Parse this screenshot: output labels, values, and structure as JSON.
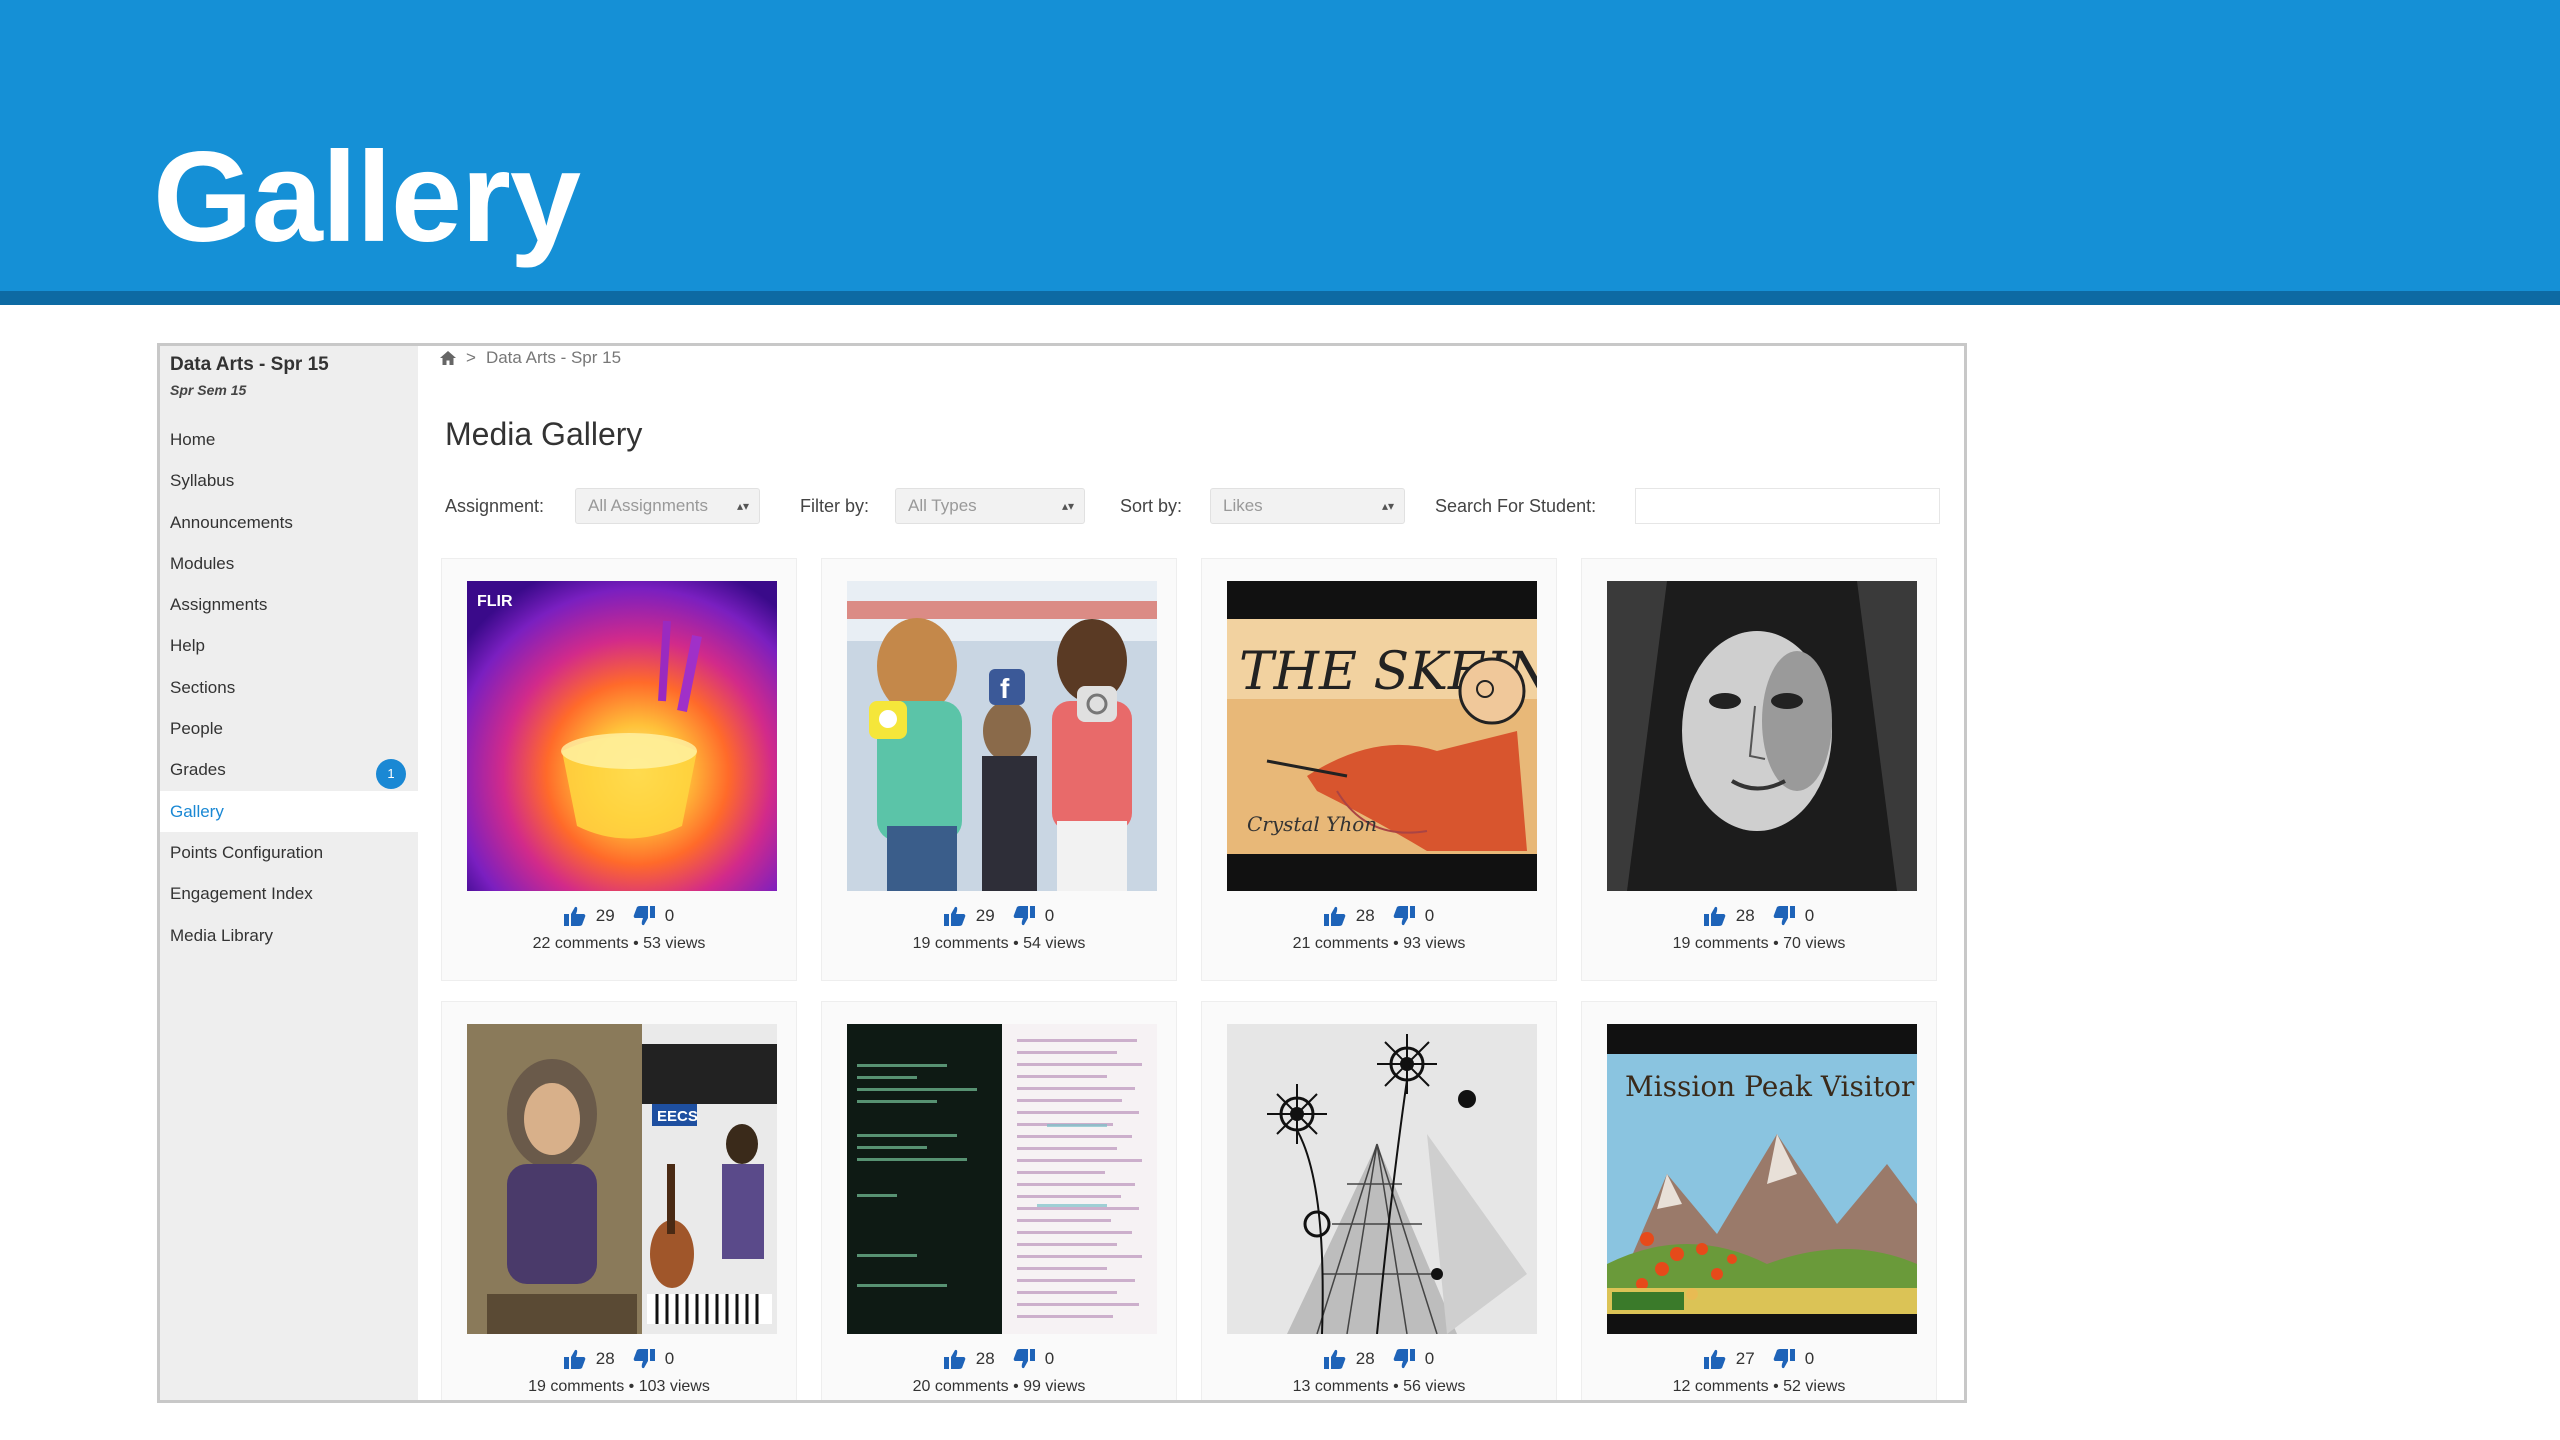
{
  "slide": {
    "title": "Gallery"
  },
  "sidebar": {
    "course_title": "Data Arts - Spr 15",
    "course_subtitle": "Spr Sem 15",
    "items": [
      {
        "label": "Home"
      },
      {
        "label": "Syllabus"
      },
      {
        "label": "Announcements"
      },
      {
        "label": "Modules"
      },
      {
        "label": "Assignments"
      },
      {
        "label": "Help"
      },
      {
        "label": "Sections"
      },
      {
        "label": "People"
      },
      {
        "label": "Grades",
        "badge": "1"
      },
      {
        "label": "Gallery",
        "active": true
      },
      {
        "label": "Points Configuration"
      },
      {
        "label": "Engagement Index"
      },
      {
        "label": "Media Library"
      }
    ]
  },
  "breadcrumb": {
    "icon": "home-icon",
    "separator": ">",
    "current": "Data Arts - Spr 15"
  },
  "main": {
    "title": "Media Gallery"
  },
  "filters": {
    "assignment_label": "Assignment:",
    "assignment_value": "All Assignments",
    "filter_label": "Filter by:",
    "filter_value": "All Types",
    "sort_label": "Sort by:",
    "sort_value": "Likes",
    "search_label": "Search For Student:",
    "search_value": ""
  },
  "colors": {
    "header": "#1590d6",
    "header_rule": "#0d6aa3",
    "accent": "#1a88d4",
    "sidebar_bg": "#eeeeee"
  },
  "gallery": [
    {
      "art": "thermal-image",
      "likes": "29",
      "dislikes": "0",
      "meta": "22 comments • 53 views",
      "watermark": "FLIR"
    },
    {
      "art": "social-media-girls-image",
      "likes": "29",
      "dislikes": "0",
      "meta": "19 comments • 54 views"
    },
    {
      "art": "the-skein-comic-image",
      "likes": "28",
      "dislikes": "0",
      "meta": "21 comments • 93 views",
      "art_text": "THE SKEIN"
    },
    {
      "art": "portrait-sketch-image",
      "likes": "28",
      "dislikes": "0",
      "meta": "19 comments • 70 views"
    },
    {
      "art": "illustration-collage-image",
      "likes": "28",
      "dislikes": "0",
      "meta": "19 comments • 103 views",
      "art_text": "EECS"
    },
    {
      "art": "code-text-image",
      "likes": "28",
      "dislikes": "0",
      "meta": "20 comments • 99 views"
    },
    {
      "art": "flowers-spiderweb-image",
      "likes": "28",
      "dislikes": "0",
      "meta": "13 comments • 56 views"
    },
    {
      "art": "mission-peak-image",
      "likes": "27",
      "dislikes": "0",
      "meta": "12 comments • 52 views",
      "art_text": "Mission Peak Visitor"
    }
  ]
}
